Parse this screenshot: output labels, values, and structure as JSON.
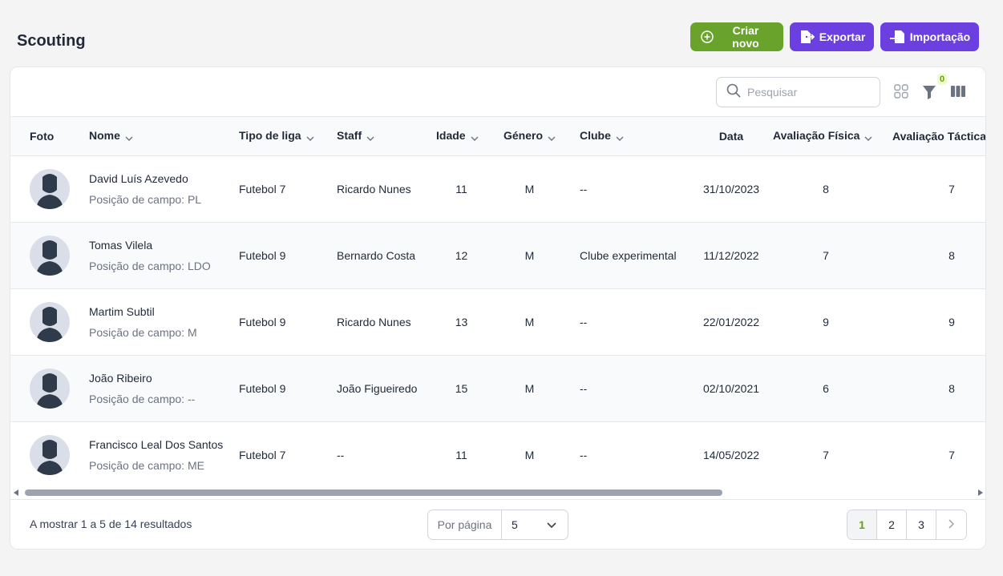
{
  "page": {
    "title": "Scouting"
  },
  "actions": {
    "create": "Criar novo",
    "export": "Exportar",
    "import": "Importação"
  },
  "colors": {
    "green": "#6aa32b",
    "purple": "#6b3fe0",
    "active_page": "#65a30d"
  },
  "toolbar": {
    "search_placeholder": "Pesquisar",
    "filter_count": "0"
  },
  "table": {
    "headers": {
      "foto": "Foto",
      "nome": "Nome",
      "tipo": "Tipo de liga",
      "staff": "Staff",
      "idade": "Idade",
      "genero": "Género",
      "clube": "Clube",
      "data": "Data",
      "fisica": "Avaliação Física",
      "tactica": "Avaliação Táctica"
    },
    "rows": [
      {
        "name": "David Luís Azevedo",
        "position": "Posição de campo: PL",
        "league": "Futebol 7",
        "staff": "Ricardo Nunes",
        "age": "11",
        "gender": "M",
        "club": "--",
        "date": "31/10/2023",
        "physical": "8",
        "tactical": "7"
      },
      {
        "name": "Tomas Vilela",
        "position": "Posição de campo: LDO",
        "league": "Futebol 9",
        "staff": "Bernardo Costa",
        "age": "12",
        "gender": "M",
        "club": "Clube experimental",
        "date": "11/12/2022",
        "physical": "7",
        "tactical": "8"
      },
      {
        "name": "Martim Subtil",
        "position": "Posição de campo: M",
        "league": "Futebol 9",
        "staff": "Ricardo Nunes",
        "age": "13",
        "gender": "M",
        "club": "--",
        "date": "22/01/2022",
        "physical": "9",
        "tactical": "9"
      },
      {
        "name": "João Ribeiro",
        "position": "Posição de campo: --",
        "league": "Futebol 9",
        "staff": "João Figueiredo",
        "age": "15",
        "gender": "M",
        "club": "--",
        "date": "02/10/2021",
        "physical": "6",
        "tactical": "8"
      },
      {
        "name": "Francisco Leal Dos Santos",
        "position": "Posição de campo: ME",
        "league": "Futebol 7",
        "staff": "--",
        "age": "11",
        "gender": "M",
        "club": "--",
        "date": "14/05/2022",
        "physical": "7",
        "tactical": "7"
      }
    ]
  },
  "footer": {
    "results": "A mostrar 1 a 5 de 14 resultados",
    "per_page_label": "Por página",
    "per_page_value": "5",
    "pages": [
      "1",
      "2",
      "3"
    ]
  }
}
